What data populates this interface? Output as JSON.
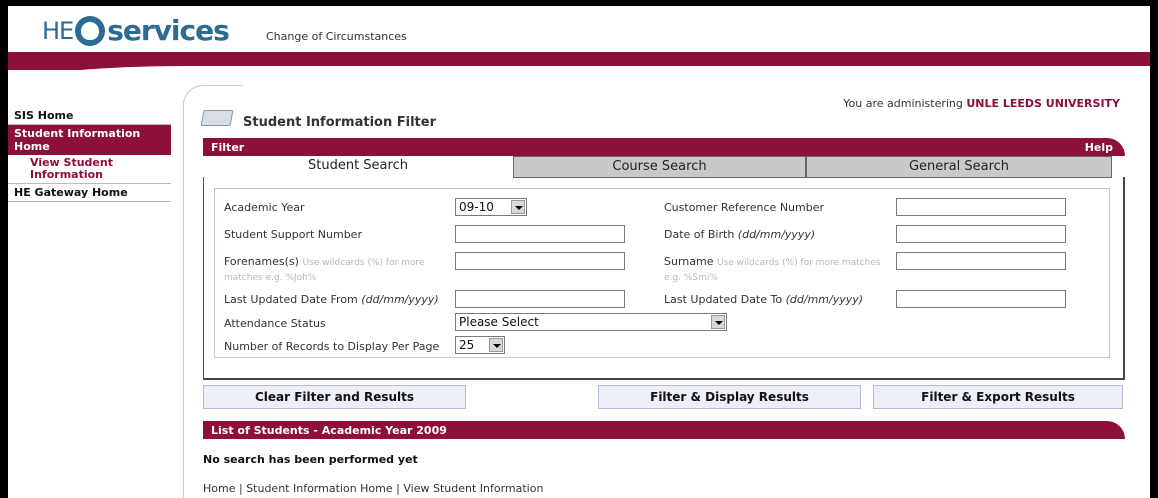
{
  "header": {
    "logo_he": "HE",
    "logo_services": "services",
    "subtitle": "Change of Circumstances"
  },
  "sidebar": {
    "items": [
      {
        "label": "SIS Home"
      },
      {
        "label": "Student Information Home"
      },
      {
        "label": "View Student Information"
      },
      {
        "label": "HE Gateway Home"
      }
    ]
  },
  "admin": {
    "prefix": "You are administering",
    "institution": "UNLE LEEDS UNIVERSITY"
  },
  "page_title": "Student Information Filter",
  "filter": {
    "title": "Filter",
    "help": "Help",
    "tabs": [
      "Student Search",
      "Course Search",
      "General Search"
    ]
  },
  "form": {
    "academic_year_label": "Academic Year",
    "academic_year_value": "09-10",
    "crn_label": "Customer Reference Number",
    "ssn_label": "Student Support Number",
    "dob_label": "Date of Birth",
    "dob_hint": "(dd/mm/yyyy)",
    "forenames_label": "Forenames(s)",
    "forenames_hint": "Use wildcards (%) for more matches e.g. %Joh%",
    "surname_label": "Surname",
    "surname_hint": "Use wildcards (%) for more matches e.g. %Smi%",
    "last_from_label": "Last Updated Date From",
    "last_from_hint": "(dd/mm/yyyy)",
    "last_to_label": "Last Updated Date To",
    "last_to_hint": "(dd/mm/yyyy)",
    "attendance_label": "Attendance Status",
    "attendance_value": "Please Select",
    "records_label": "Number of Records to Display Per Page",
    "records_value": "25"
  },
  "buttons": {
    "clear": "Clear Filter and Results",
    "display": "Filter & Display Results",
    "export": "Filter & Export Results"
  },
  "list": {
    "title": "List of Students - Academic Year 2009",
    "empty": "No search has been performed yet"
  },
  "footer": {
    "links": [
      "Home",
      "Student Information Home",
      "View Student Information"
    ],
    "sep": " | "
  },
  "colors": {
    "brand": "#8c1038",
    "logo": "#2c6b93"
  }
}
